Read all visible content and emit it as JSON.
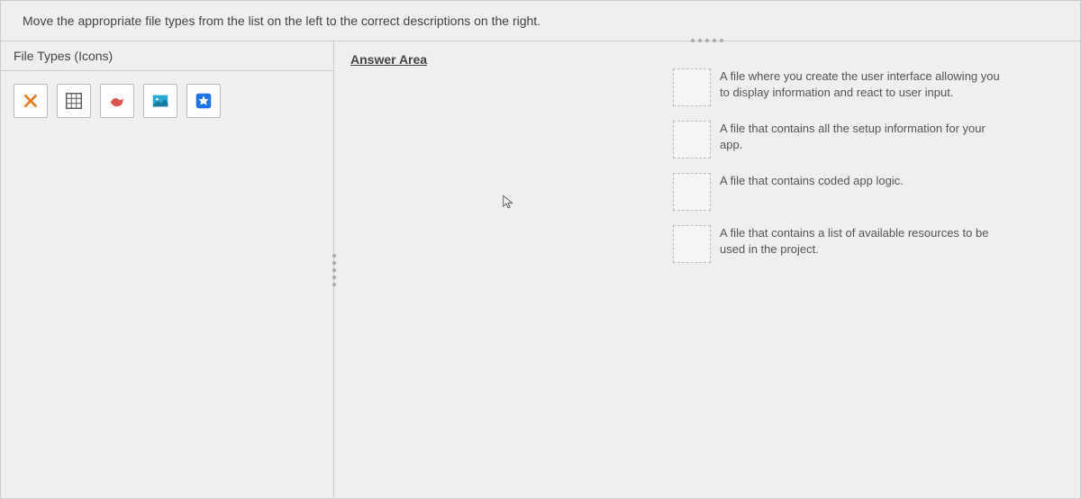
{
  "header": {
    "instruction": "Move the appropriate file types from the list on the left to the correct descriptions on the right."
  },
  "left_panel": {
    "title": "File Types (Icons)",
    "icons": [
      {
        "name": "x-icon"
      },
      {
        "name": "grid-icon"
      },
      {
        "name": "bird-icon"
      },
      {
        "name": "gallery-icon"
      },
      {
        "name": "app-icon"
      }
    ]
  },
  "answer_area": {
    "title": "Answer Area",
    "rows": [
      {
        "description": "A file where you create the user interface allowing you to display information and react to user input."
      },
      {
        "description": "A file that contains all the setup information for your app."
      },
      {
        "description": "A file that contains coded app logic."
      },
      {
        "description": "A file that contains a list of available resources to be used in the project."
      }
    ]
  }
}
